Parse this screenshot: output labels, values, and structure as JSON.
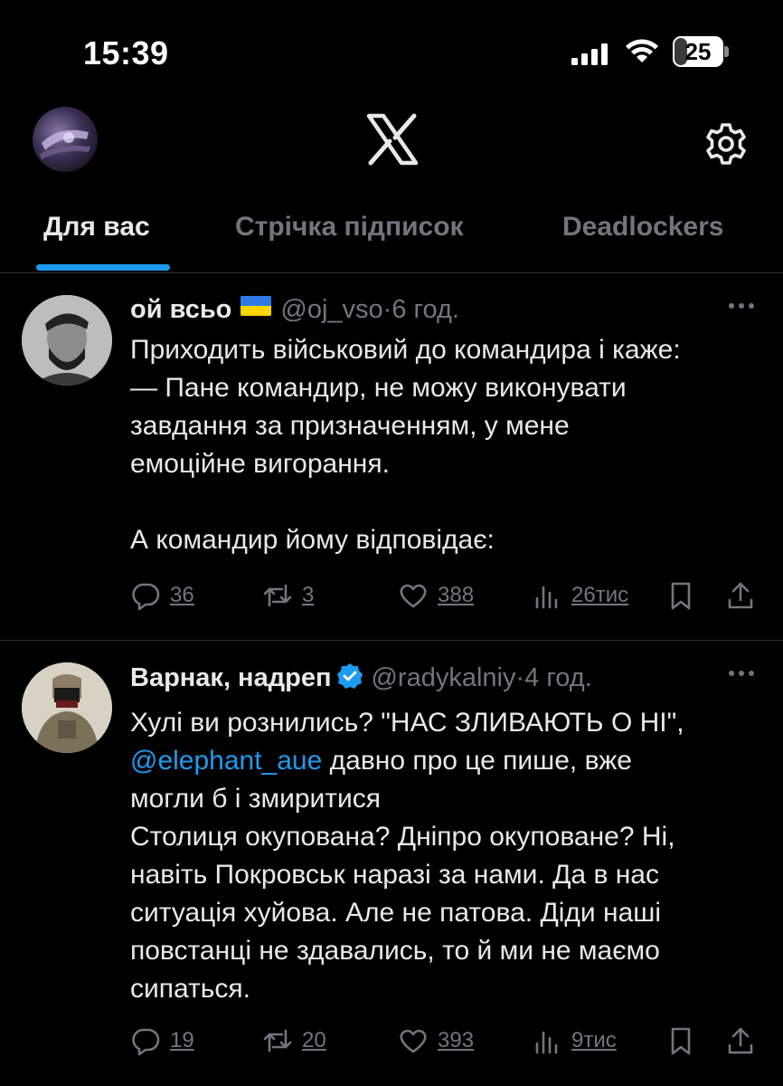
{
  "status_bar": {
    "time": "15:39",
    "battery_level": "25"
  },
  "header": {
    "logo": "x-logo",
    "settings_icon": "gear-icon"
  },
  "tabs": [
    {
      "label": "Для вас",
      "active": true
    },
    {
      "label": "Стрічка підписок",
      "active": false
    },
    {
      "label": "Deadlockers",
      "active": false
    }
  ],
  "posts": [
    {
      "name": "ой всьо",
      "handle": "@oj_vso",
      "dot": "·",
      "time": "6 год.",
      "lines": [
        "Приходить військовий до командира і каже:",
        "— Пане командир, не можу виконувати",
        "завдання за призначенням, у мене",
        "емоційне вигорання.",
        "",
        "А командир йому відповідає:"
      ],
      "replies": "36",
      "reposts": "3",
      "likes": "388",
      "views": "26тис"
    },
    {
      "name": "Варнак, надреп",
      "handle": "@radykalniy",
      "dot": "·",
      "time": "4 год.",
      "line1": "Хулі ви рознились? \"НАС ЗЛИВАЮТЬ О НІ\",",
      "mention": "@elephant_aue",
      "line2_rest": " давно про це пише, вже",
      "lines_after": [
        "могли б і змиритися",
        "Столиця окупована? Дніпро окуповане? Ні,",
        "навіть Покровськ наразі за нами. Да в нас",
        "ситуація хуйова. Але не патова. Діди наші",
        "повстанці не здавались, то й ми не маємо",
        "сипаться."
      ],
      "replies": "19",
      "reposts": "20",
      "likes": "393",
      "views": "9тис"
    }
  ],
  "colors": {
    "accent": "#1d9bf0",
    "muted": "#71767b",
    "text": "#e7e9ea",
    "background": "#000000"
  }
}
